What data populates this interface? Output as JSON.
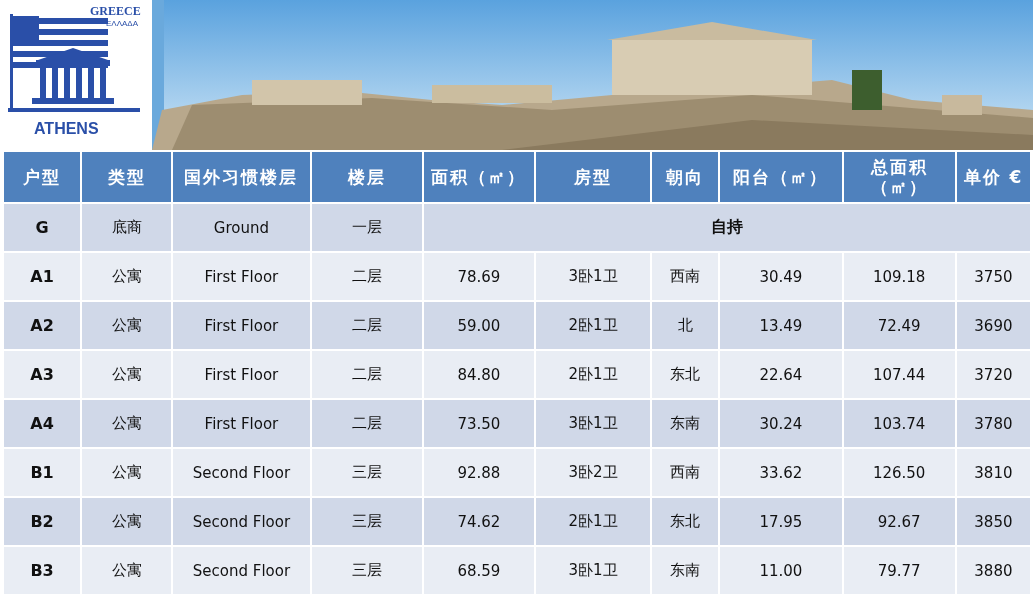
{
  "banner": {
    "logo": {
      "top_text": "GREECE",
      "sub_text": "ΕΛΛΑΔΑ",
      "bottom_text": "ATHENS"
    }
  },
  "table": {
    "columns": [
      "户型",
      "类型",
      "国外习惯楼层",
      "楼层",
      "面积（㎡）",
      "房型",
      "朝向",
      "阳台（㎡）",
      "总面积（㎡）",
      "单价 €"
    ],
    "rows": [
      {
        "kind": "reserved",
        "cells": [
          "G",
          "底商",
          "Ground",
          "一层"
        ],
        "note": "自持"
      },
      {
        "kind": "unit",
        "cells": [
          "A1",
          "公寓",
          "First Floor",
          "二层",
          "78.69",
          "3卧1卫",
          "西南",
          "30.49",
          "109.18",
          "3750"
        ]
      },
      {
        "kind": "unit",
        "cells": [
          "A2",
          "公寓",
          "First Floor",
          "二层",
          "59.00",
          "2卧1卫",
          "北",
          "13.49",
          "72.49",
          "3690"
        ]
      },
      {
        "kind": "unit",
        "cells": [
          "A3",
          "公寓",
          "First Floor",
          "二层",
          "84.80",
          "2卧1卫",
          "东北",
          "22.64",
          "107.44",
          "3720"
        ]
      },
      {
        "kind": "unit",
        "cells": [
          "A4",
          "公寓",
          "First Floor",
          "二层",
          "73.50",
          "3卧1卫",
          "东南",
          "30.24",
          "103.74",
          "3780"
        ]
      },
      {
        "kind": "unit",
        "cells": [
          "B1",
          "公寓",
          "Second Floor",
          "三层",
          "92.88",
          "3卧2卫",
          "西南",
          "33.62",
          "126.50",
          "3810"
        ]
      },
      {
        "kind": "unit",
        "cells": [
          "B2",
          "公寓",
          "Second Floor",
          "三层",
          "74.62",
          "2卧1卫",
          "东北",
          "17.95",
          "92.67",
          "3850"
        ]
      },
      {
        "kind": "unit",
        "cells": [
          "B3",
          "公寓",
          "Second Floor",
          "三层",
          "68.59",
          "3卧1卫",
          "东南",
          "11.00",
          "79.77",
          "3880"
        ]
      }
    ]
  }
}
